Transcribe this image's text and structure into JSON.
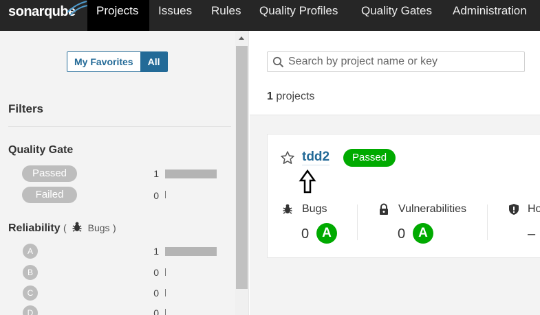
{
  "logo": {
    "brand": "sonarqube"
  },
  "nav": {
    "items": [
      {
        "label": "Projects",
        "active": true
      },
      {
        "label": "Issues"
      },
      {
        "label": "Rules"
      },
      {
        "label": "Quality Profiles"
      },
      {
        "label": "Quality Gates"
      },
      {
        "label": "Administration"
      }
    ]
  },
  "sidebar": {
    "favorites_label": "My Favorites",
    "all_label": "All",
    "filters_title": "Filters",
    "quality_gate": {
      "title": "Quality Gate",
      "options": [
        {
          "label": "Passed",
          "count": "1",
          "fraction": 1.0
        },
        {
          "label": "Failed",
          "count": "0",
          "fraction": 0
        }
      ]
    },
    "reliability": {
      "title": "Reliability",
      "paren_open": "(",
      "sub": "Bugs",
      "paren_close": ")",
      "icon": "bug-icon",
      "options": [
        {
          "label": "A",
          "count": "1",
          "fraction": 1.0
        },
        {
          "label": "B",
          "count": "0",
          "fraction": 0
        },
        {
          "label": "C",
          "count": "0",
          "fraction": 0
        },
        {
          "label": "D",
          "count": "0",
          "fraction": 0
        }
      ]
    }
  },
  "main": {
    "search": {
      "placeholder": "Search by project name or key",
      "value": ""
    },
    "projects_count": "1",
    "projects_label": "projects",
    "project": {
      "name": "tdd2",
      "status": "Passed",
      "measures": [
        {
          "label": "Bugs",
          "icon": "bug-icon",
          "value": "0",
          "rating": "A"
        },
        {
          "label": "Vulnerabilities",
          "icon": "lock-icon",
          "value": "0",
          "rating": "A"
        },
        {
          "label": "Ho",
          "icon": "shield-icon",
          "value": "–"
        }
      ]
    }
  },
  "colors": {
    "nav_bg": "#262626",
    "accent_blue": "#236a97",
    "passed_green": "#00aa00",
    "facet_gray": "#bdbdbd"
  }
}
